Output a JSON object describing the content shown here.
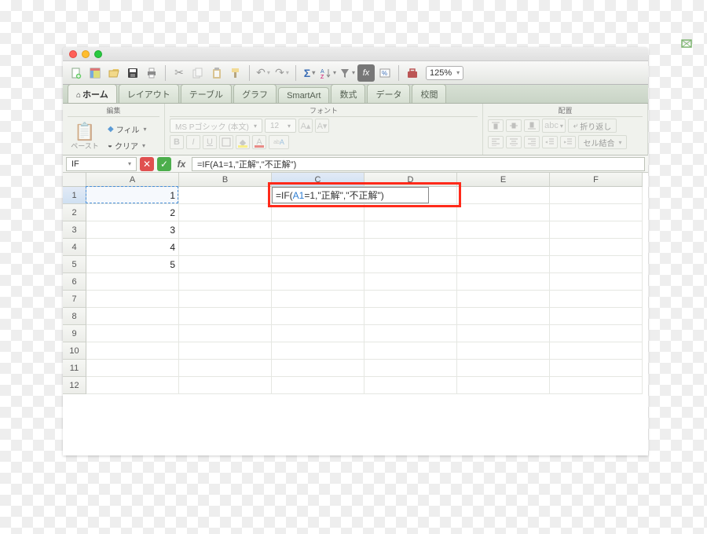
{
  "zoom": "125%",
  "ribbon": {
    "tabs": [
      "ホーム",
      "レイアウト",
      "テーブル",
      "グラフ",
      "SmartArt",
      "数式",
      "データ",
      "校閲"
    ],
    "active": 0,
    "groups": {
      "edit": {
        "title": "編集",
        "paste": "ペースト",
        "fill": "フィル",
        "clear": "クリア"
      },
      "font": {
        "title": "フォント",
        "name": "MS Pゴシック (本文)",
        "size": "12"
      },
      "align": {
        "title": "配置",
        "wrap": "折り返し",
        "merge": "セル結合"
      }
    }
  },
  "formula_bar": {
    "name_box": "IF",
    "formula": "=IF(A1=1,\"正解\",\"不正解\")"
  },
  "sheet": {
    "columns": [
      "A",
      "B",
      "C",
      "D",
      "E",
      "F"
    ],
    "rows": [
      "1",
      "2",
      "3",
      "4",
      "5",
      "6",
      "7",
      "8",
      "9",
      "10",
      "11",
      "12"
    ],
    "selected_row": 0,
    "selected_cols": [
      2
    ],
    "a_values": [
      "1",
      "2",
      "3",
      "4",
      "5"
    ],
    "edit_cell_display_prefix": "=IF(",
    "edit_cell_display_ref": "A1",
    "edit_cell_display_suffix": "=1,\"正解\",\"不正解\")"
  },
  "icons": {
    "new": "new-doc-icon",
    "open": "open-icon",
    "import": "import-icon",
    "save": "save-icon",
    "print": "print-icon",
    "cut": "cut-icon",
    "copy": "copy-icon",
    "paste": "paste-icon",
    "format_painter": "format-painter-icon",
    "undo": "undo-icon",
    "redo": "redo-icon",
    "autosum": "autosum-icon",
    "sort": "sort-icon",
    "filter": "filter-icon",
    "fx": "fx-icon",
    "show_formulas": "show-formulas-icon",
    "toolbox": "toolbox-icon"
  }
}
